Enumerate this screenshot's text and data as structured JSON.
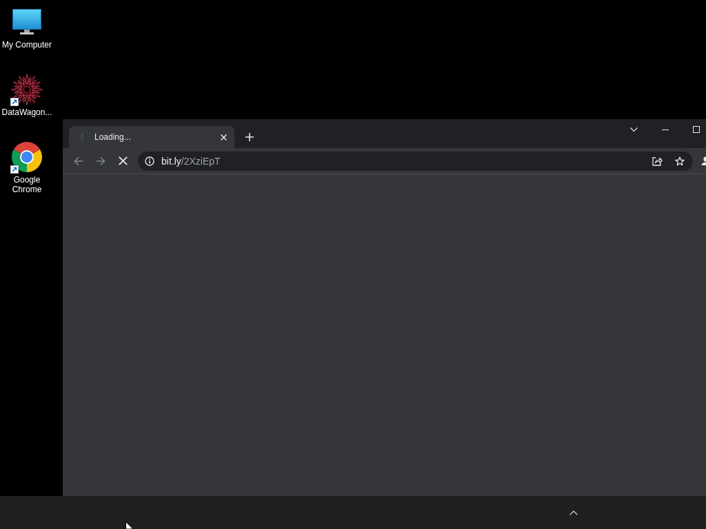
{
  "desktop_icons": [
    {
      "label": "My Computer",
      "kind": "monitor",
      "shortcut": false
    },
    {
      "label": "DataWagon...",
      "kind": "starburst",
      "shortcut": true
    },
    {
      "label": "Google Chrome",
      "kind": "ring",
      "shortcut": true
    }
  ],
  "browser": {
    "tabs": [
      {
        "title": "Loading...",
        "loading": true,
        "selected": true
      }
    ],
    "toolbar": {
      "back_disabled": true,
      "forward_disabled": true,
      "loading": true
    },
    "address_bar": {
      "host": "bit.ly",
      "path": "/2XziEpT",
      "bookmarked": false
    }
  }
}
